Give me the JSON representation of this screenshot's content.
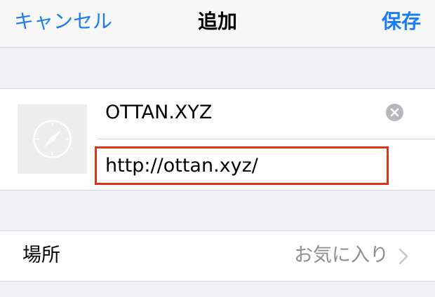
{
  "navbar": {
    "cancel_label": "キャンセル",
    "title": "追加",
    "save_label": "保存"
  },
  "bookmark": {
    "title_value": "OTTAN.XYZ",
    "url_value": "http://ottan.xyz/",
    "thumbnail_icon": "compass-icon",
    "clear_icon": "clear-icon"
  },
  "location": {
    "label": "場所",
    "value": "お気に入り",
    "chevron_icon": "chevron-right-icon"
  },
  "colors": {
    "accent": "#1a7cf4",
    "highlight_border": "#e03217",
    "background": "#efeff4",
    "secondary_text": "#8e8e93"
  }
}
